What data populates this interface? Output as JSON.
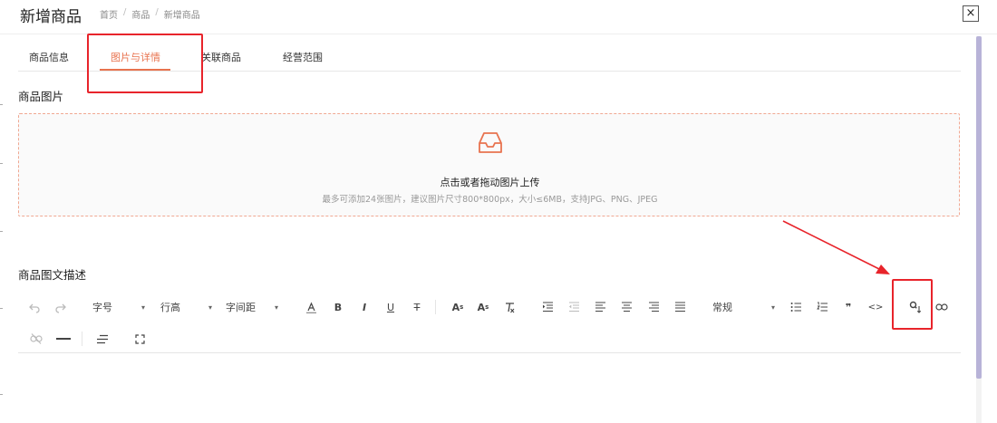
{
  "header": {
    "title": "新增商品",
    "breadcrumb": [
      "首页",
      "商品",
      "新增商品"
    ],
    "close_label": "×"
  },
  "tabs": [
    {
      "label": "商品信息",
      "active": false
    },
    {
      "label": "图片与详情",
      "active": true
    },
    {
      "label": "关联商品",
      "active": false
    },
    {
      "label": "经营范围",
      "active": false
    }
  ],
  "product_images": {
    "label": "商品图片",
    "upload_title": "点击或者拖动图片上传",
    "upload_hint": "最多可添加24张图片，建议图片尺寸800*800px，大小≤6MB，支持JPG、PNG、JPEG",
    "icon": "inbox-icon"
  },
  "description": {
    "label": "商品图文描述"
  },
  "toolbar": {
    "undo_icon": "undo-icon",
    "redo_icon": "redo-icon",
    "font_size": "字号",
    "line_height": "行高",
    "letter_spacing": "字间距",
    "heading": "常规",
    "superscript_glyph": "A",
    "subscript_glyph": "A",
    "sup_mark": "s",
    "sub_mark": "s",
    "quote_glyph": "❞",
    "code_glyph": "<>"
  },
  "colors": {
    "accent": "#e8734f",
    "annotation_red": "#e8242b",
    "scroll_thumb": "#b8b3d8"
  }
}
